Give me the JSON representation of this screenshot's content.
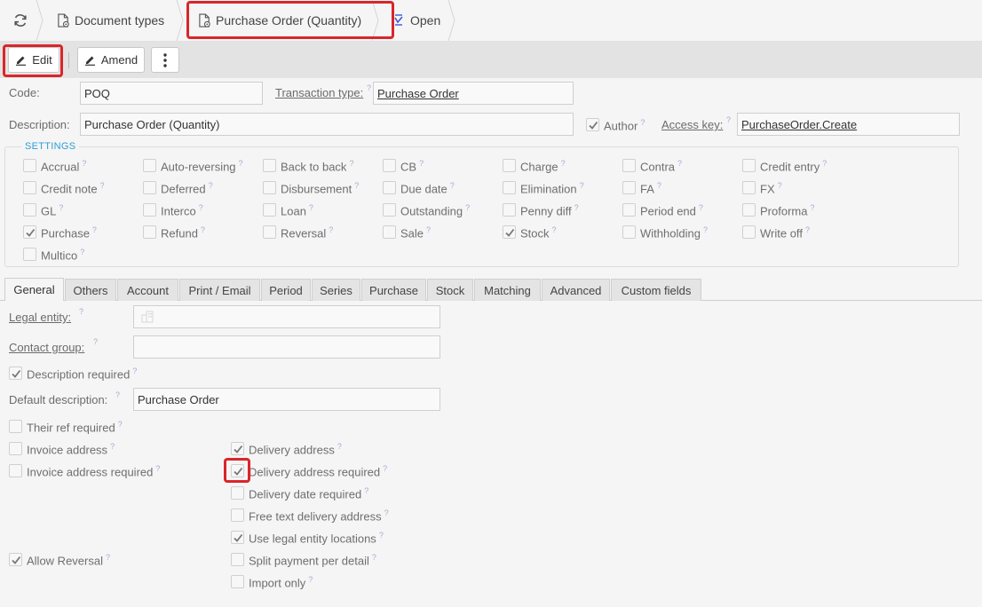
{
  "breadcrumb": {
    "refresh_icon": "refresh-icon",
    "doc_types": "Document types",
    "current": "Purchase Order (Quantity)",
    "open": "Open"
  },
  "toolbar": {
    "edit": "Edit",
    "amend": "Amend",
    "more_icon": "more-vertical-icon"
  },
  "form": {
    "code_label": "Code:",
    "code_value": "POQ",
    "transaction_type_label": "Transaction type:",
    "transaction_type_value": "Purchase Order",
    "description_label": "Description:",
    "description_value": "Purchase Order (Quantity)",
    "author_label": "Author",
    "author_checked": true,
    "access_key_label": "Access key:",
    "access_key_value": "PurchaseOrder.Create"
  },
  "settings": {
    "title": "SETTINGS",
    "rows": [
      [
        {
          "label": "Accrual",
          "checked": false
        },
        {
          "label": "Auto-reversing",
          "checked": false
        },
        {
          "label": "Back to back",
          "checked": false
        },
        {
          "label": "CB",
          "checked": false
        },
        {
          "label": "Charge",
          "checked": false
        },
        {
          "label": "Contra",
          "checked": false
        },
        {
          "label": "Credit entry",
          "checked": false
        }
      ],
      [
        {
          "label": "Credit note",
          "checked": false
        },
        {
          "label": "Deferred",
          "checked": false
        },
        {
          "label": "Disbursement",
          "checked": false
        },
        {
          "label": "Due date",
          "checked": false
        },
        {
          "label": "Elimination",
          "checked": false
        },
        {
          "label": "FA",
          "checked": false
        },
        {
          "label": "FX",
          "checked": false
        }
      ],
      [
        {
          "label": "GL",
          "checked": false
        },
        {
          "label": "Interco",
          "checked": false
        },
        {
          "label": "Loan",
          "checked": false
        },
        {
          "label": "Outstanding",
          "checked": false
        },
        {
          "label": "Penny diff",
          "checked": false
        },
        {
          "label": "Period end",
          "checked": false
        },
        {
          "label": "Proforma",
          "checked": false
        }
      ],
      [
        {
          "label": "Purchase",
          "checked": true
        },
        {
          "label": "Refund",
          "checked": false
        },
        {
          "label": "Reversal",
          "checked": false
        },
        {
          "label": "Sale",
          "checked": false
        },
        {
          "label": "Stock",
          "checked": true
        },
        {
          "label": "Withholding",
          "checked": false
        },
        {
          "label": "Write off",
          "checked": false
        }
      ],
      [
        {
          "label": "Multico",
          "checked": false
        }
      ]
    ]
  },
  "tabs": [
    "General",
    "Others",
    "Account",
    "Print / Email",
    "Period",
    "Series",
    "Purchase",
    "Stock",
    "Matching",
    "Advanced",
    "Custom fields"
  ],
  "active_tab": "General",
  "general": {
    "legal_entity_label": "Legal entity:",
    "contact_group_label": "Contact group:",
    "description_required": "Description required",
    "default_description_label": "Default description:",
    "default_description_value": "Purchase Order",
    "their_ref_required": "Their ref required",
    "invoice_address": "Invoice address",
    "invoice_address_required": "Invoice address required",
    "delivery_address": "Delivery address",
    "delivery_address_required": "Delivery address required",
    "delivery_date_required": "Delivery date required",
    "free_text_delivery_address": "Free text delivery address",
    "use_legal_entity_locations": "Use legal entity locations",
    "split_payment_per_detail": "Split payment per detail",
    "import_only": "Import only",
    "allow_reversal": "Allow Reversal"
  },
  "help_marker": "?",
  "colors": {
    "highlight": "#d9262b",
    "accent": "#2a9fd6",
    "toolbar_bg": "#e3e3e3"
  }
}
